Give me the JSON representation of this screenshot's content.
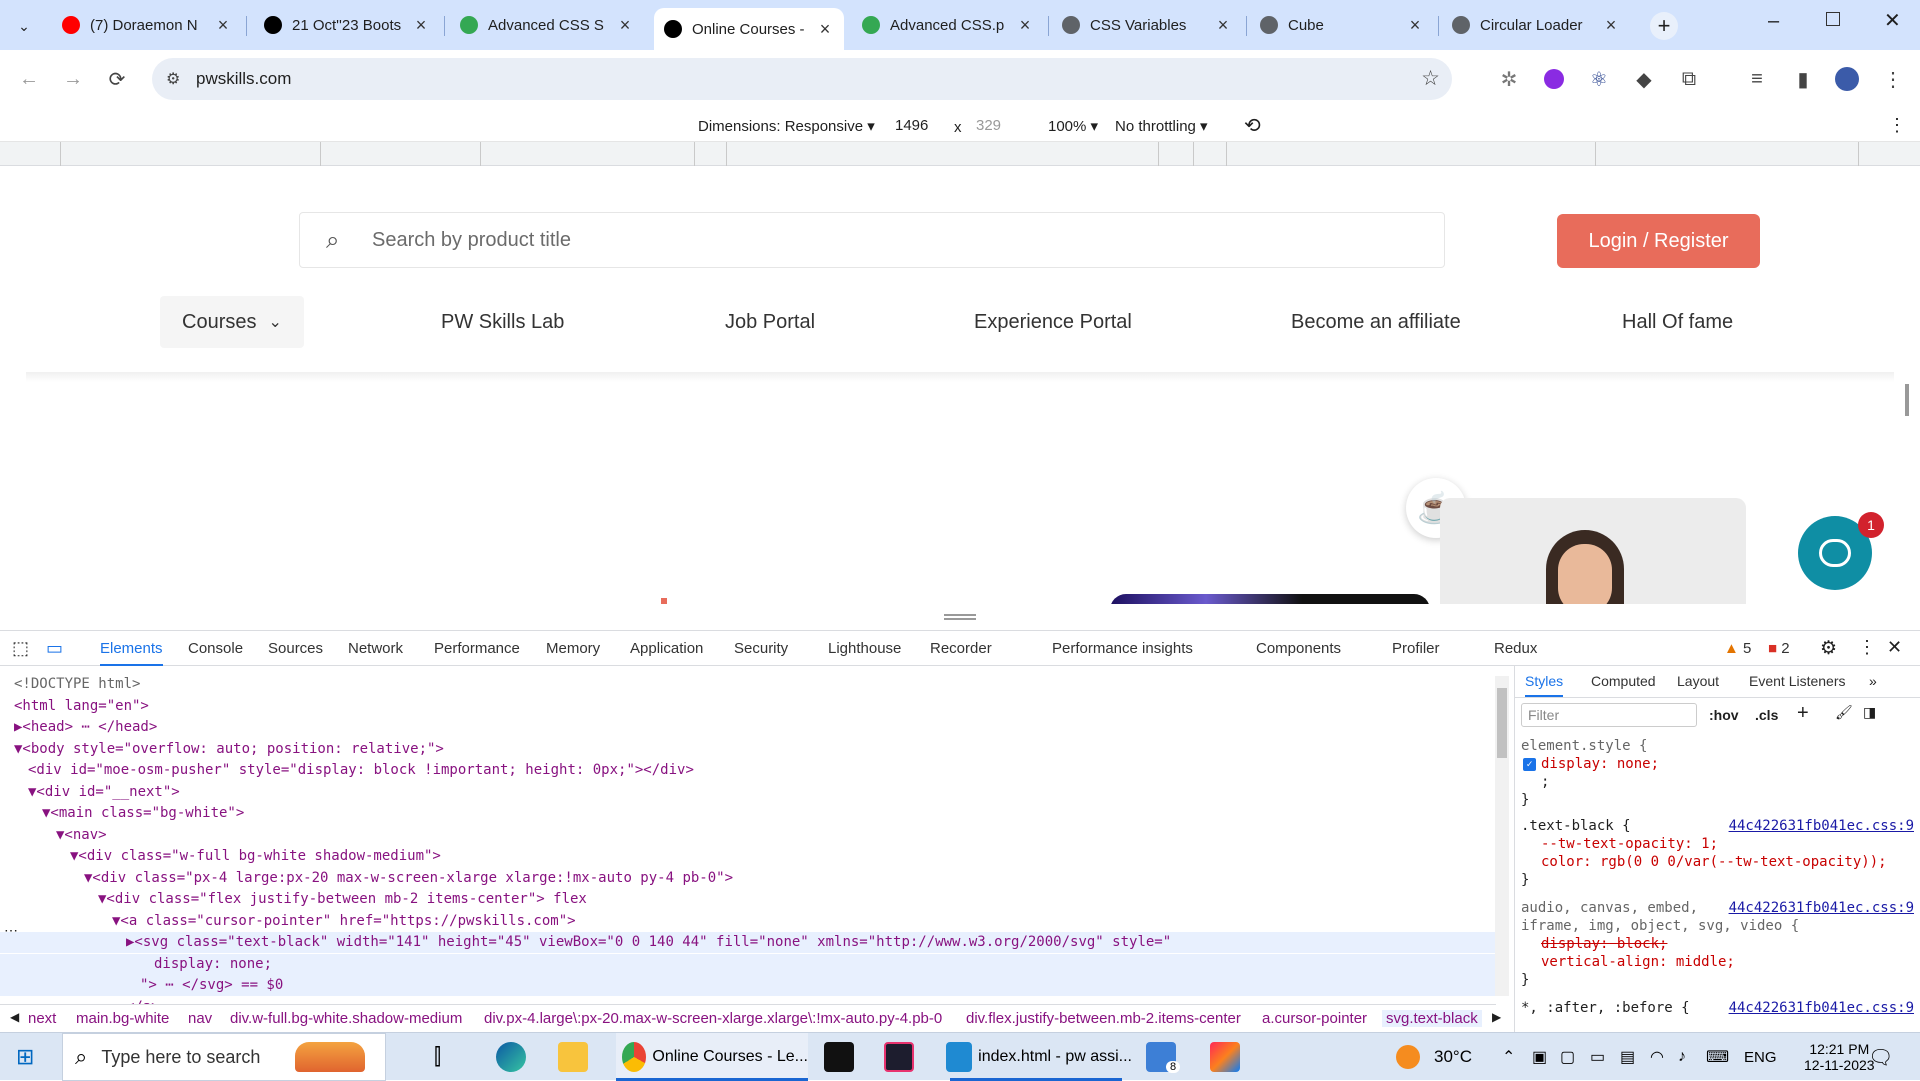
{
  "browser": {
    "tabs": [
      {
        "title": "(7) Doraemon N",
        "favicon": "youtube-icon",
        "color": "#ff0000"
      },
      {
        "title": "21 Oct''23 Boots",
        "favicon": "notion-icon",
        "color": "#000000"
      },
      {
        "title": "Advanced CSS S",
        "favicon": "google-drive-icon",
        "color": "#34a853"
      },
      {
        "title": "Online Courses -",
        "favicon": "pwskills-icon",
        "color": "#000000"
      },
      {
        "title": "Advanced CSS.p",
        "favicon": "google-drive-icon",
        "color": "#34a853"
      },
      {
        "title": "CSS Variables",
        "favicon": "globe-icon",
        "color": "#5f6368"
      },
      {
        "title": "Cube",
        "favicon": "globe-icon",
        "color": "#5f6368"
      },
      {
        "title": "Circular Loader",
        "favicon": "globe-icon",
        "color": "#5f6368"
      }
    ],
    "url": "pwskills.com"
  },
  "device_toolbar": {
    "dimensions_label": "Dimensions: Responsive",
    "width": "1496",
    "times": "x",
    "height": "329",
    "zoom": "100%",
    "throttle": "No throttling"
  },
  "page": {
    "search_placeholder": "Search by product title",
    "login_label": "Login / Register",
    "nav": [
      "Courses",
      "PW Skills Lab",
      "Job Portal",
      "Experience Portal",
      "Become an affiliate",
      "Hall Of fame"
    ],
    "chat_badge": "1"
  },
  "devtools": {
    "tabs": [
      "Elements",
      "Console",
      "Sources",
      "Network",
      "Performance",
      "Memory",
      "Application",
      "Security",
      "Lighthouse",
      "Recorder",
      "Performance insights",
      "Components",
      "Profiler",
      "Redux"
    ],
    "warnings": "5",
    "errors": "2",
    "dom_lines": [
      {
        "indent": 0,
        "text": "<!DOCTYPE html>"
      },
      {
        "indent": 0,
        "text": "<html lang=\"en\">"
      },
      {
        "indent": 0,
        "text": "▶<head> ⋯ </head>"
      },
      {
        "indent": 0,
        "text": "▼<body style=\"overflow: auto; position: relative;\">"
      },
      {
        "indent": 1,
        "text": "<div id=\"moe-osm-pusher\" style=\"display: block !important; height: 0px;\"></div>"
      },
      {
        "indent": 1,
        "text": "▼<div id=\"__next\">"
      },
      {
        "indent": 2,
        "text": "▼<main class=\"bg-white\">"
      },
      {
        "indent": 3,
        "text": "▼<nav>"
      },
      {
        "indent": 4,
        "text": "▼<div class=\"w-full bg-white shadow-medium\">"
      },
      {
        "indent": 5,
        "text": "▼<div class=\"px-4 large:px-20 max-w-screen-xlarge xlarge:!mx-auto py-4 pb-0\">"
      },
      {
        "indent": 6,
        "text": "▼<div class=\"flex justify-between mb-2 items-center\"> flex"
      },
      {
        "indent": 7,
        "text": "▼<a class=\"cursor-pointer\" href=\"https://pwskills.com\">"
      },
      {
        "indent": 8,
        "text": "▶<svg class=\"text-black\" width=\"141\" height=\"45\" viewBox=\"0 0 140 44\" fill=\"none\" xmlns=\"http://www.w3.org/2000/svg\" style=\""
      },
      {
        "indent": 10,
        "text": "display: none;"
      },
      {
        "indent": 9,
        "text": "\"> ⋯ </svg> == $0"
      },
      {
        "indent": 8,
        "text": "</a>"
      }
    ],
    "breadcrumb": [
      "next",
      "main.bg-white",
      "nav",
      "div.w-full.bg-white.shadow-medium",
      "div.px-4.large\\:px-20.max-w-screen-xlarge.xlarge\\:!mx-auto.py-4.pb-0",
      "div.flex.justify-between.mb-2.items-center",
      "a.cursor-pointer",
      "svg.text-black"
    ],
    "styles": {
      "tabs": [
        "Styles",
        "Computed",
        "Layout",
        "Event Listeners"
      ],
      "filter_placeholder": "Filter",
      "hov": ":hov",
      "cls": ".cls",
      "lines": [
        {
          "text": "element.style {",
          "cls": "cm"
        },
        {
          "text": "display: none;",
          "cls": "prop",
          "checked": true
        },
        {
          "text": "  ;",
          "cls": ""
        },
        {
          "text": "}",
          "cls": ""
        },
        {
          "text": ".text-black {",
          "cls": ""
        },
        {
          "text": "--tw-text-opacity: 1;",
          "cls": "prop"
        },
        {
          "text": "color: rgb(0 0 0/var(--tw-text-opacity));",
          "cls": "prop"
        },
        {
          "text": "}",
          "cls": ""
        },
        {
          "text": "audio, canvas, embed,",
          "cls": "cm"
        },
        {
          "text": "iframe, img, object, svg, video {",
          "cls": "cm"
        },
        {
          "text": "display: block;",
          "cls": "prop"
        },
        {
          "text": "vertical-align: middle;",
          "cls": "prop"
        },
        {
          "text": "}",
          "cls": ""
        },
        {
          "text": "*, :after, :before {",
          "cls": ""
        }
      ],
      "source": "44c422631fb041ec.css:9"
    }
  },
  "taskbar": {
    "search_placeholder": "Type here to search",
    "chrome_label": "Online Courses - Le...",
    "vscode_label": "index.html - pw assi...",
    "mail_badge": "8",
    "temperature": "30°C",
    "lang": "ENG",
    "time": "12:21 PM",
    "date": "12-11-2023"
  }
}
